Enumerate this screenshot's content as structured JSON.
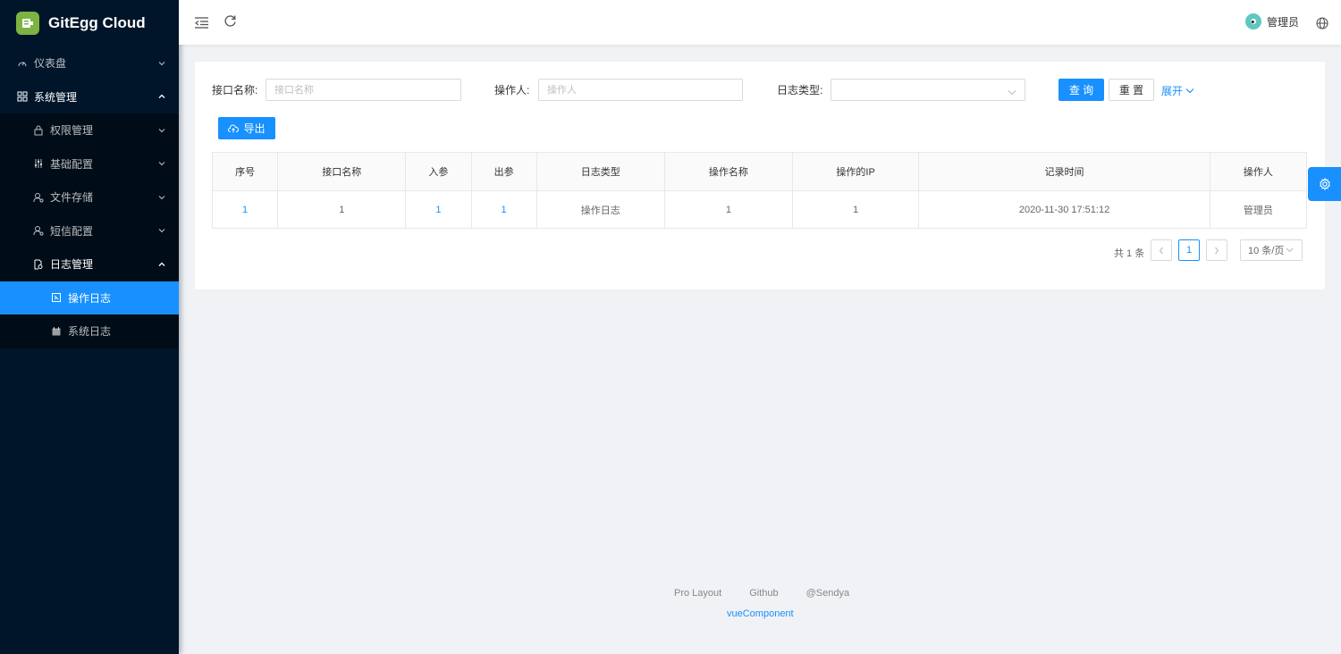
{
  "app": {
    "title": "GitEgg Cloud"
  },
  "sidebar": {
    "items": [
      {
        "label": "仪表盘",
        "icon": "dashboard-icon"
      },
      {
        "label": "系统管理",
        "icon": "appstore-icon"
      },
      {
        "label": "权限管理",
        "icon": "lock-icon"
      },
      {
        "label": "基础配置",
        "icon": "sliders-icon"
      },
      {
        "label": "文件存储",
        "icon": "user-setting-icon"
      },
      {
        "label": "短信配置",
        "icon": "user-setting-icon"
      },
      {
        "label": "日志管理",
        "icon": "file-search-icon"
      },
      {
        "label": "操作日志",
        "icon": "snippets-icon"
      },
      {
        "label": "系统日志",
        "icon": "calendar-icon"
      }
    ]
  },
  "header": {
    "user_name": "管理员"
  },
  "search": {
    "api_name_label": "接口名称:",
    "api_name_placeholder": "接口名称",
    "operator_label": "操作人:",
    "operator_placeholder": "操作人",
    "log_type_label": "日志类型:",
    "log_type_value": "",
    "query_button": "查 询",
    "reset_button": "重 置",
    "expand_link": "展开"
  },
  "toolbar": {
    "export_button": "导出"
  },
  "table": {
    "columns": [
      "序号",
      "接口名称",
      "入参",
      "出参",
      "日志类型",
      "操作名称",
      "操作的IP",
      "记录时间",
      "操作人"
    ],
    "rows": [
      [
        "1",
        "1",
        "1",
        "1",
        "操作日志",
        "1",
        "1",
        "2020-11-30 17:51:12",
        "管理员"
      ]
    ]
  },
  "pagination": {
    "total_text": "共 1 条",
    "current_page": "1",
    "page_size": "10 条/页"
  },
  "footer": {
    "links": [
      "Pro Layout",
      "Github",
      "@Sendya"
    ],
    "copyright": "vueComponent"
  },
  "colors": {
    "primary": "#1890ff",
    "sidebar_bg": "#001529",
    "submenu_bg": "#000c17",
    "page_bg": "#f0f2f5"
  }
}
